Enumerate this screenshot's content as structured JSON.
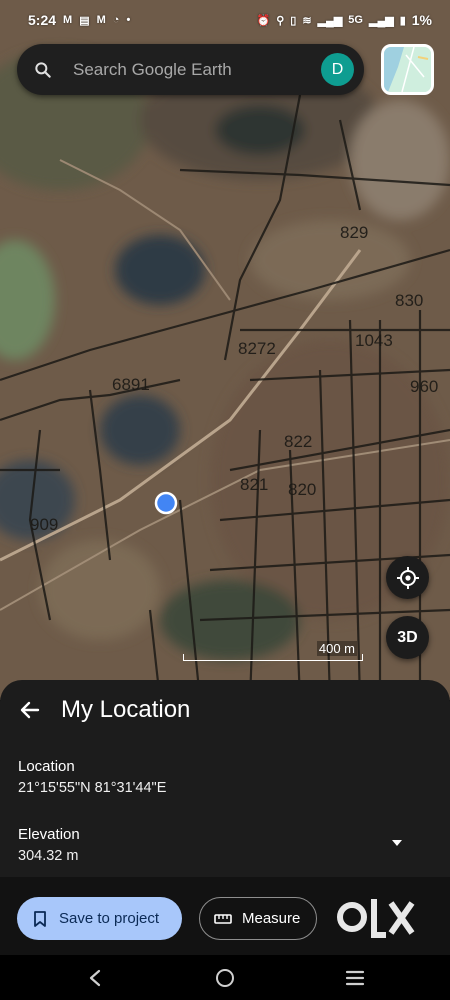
{
  "status_bar": {
    "time": "5:24",
    "left_icons": [
      "gmail-icon",
      "news-icon",
      "gmail-icon",
      "whatsapp-icon",
      "dot-icon"
    ],
    "network": "5G",
    "battery": "1%"
  },
  "search": {
    "placeholder": "Search Google Earth",
    "avatar_letter": "D"
  },
  "map": {
    "parcel_labels": [
      "829",
      "830",
      "1043",
      "8272",
      "6891",
      "822",
      "821",
      "820",
      "960",
      "909"
    ],
    "scale_label": "400 m"
  },
  "controls": {
    "three_d_label": "3D"
  },
  "sheet": {
    "title": "My Location",
    "location_label": "Location",
    "location_value": "21°15'55\"N 81°31'44\"E",
    "elevation_label": "Elevation",
    "elevation_value": "304.32 m",
    "save_label": "Save to project",
    "measure_label": "Measure"
  },
  "colors": {
    "accent": "#a8c7fa",
    "avatar": "#0e9d91",
    "location_dot": "#4285f4"
  }
}
